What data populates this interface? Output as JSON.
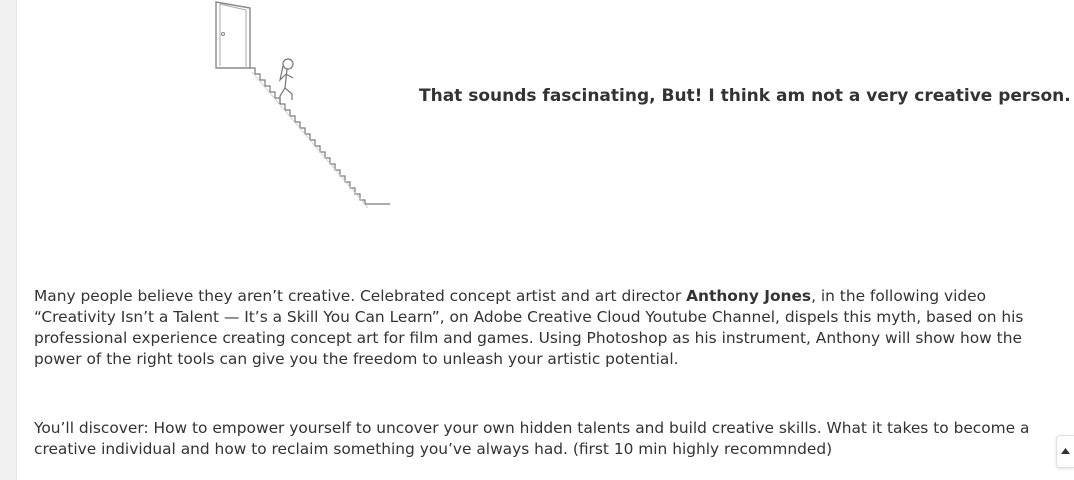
{
  "callout": {
    "text": "That sounds fascinating, But! I think am not a very creative person."
  },
  "paragraph1": {
    "before": "Many people believe they aren’t creative. Celebrated concept artist and art director ",
    "name": "Anthony Jones",
    "after": ", in the following video “Creativity Isn’t a Talent — It’s a Skill You Can Learn”, on Adobe Creative Cloud Youtube Channel, dispels this myth, based on his professional experience creating concept art for film and games. Using Photoshop as his instrument, Anthony will show how the power of the right tools can give you the freedom to unleash your artistic potential."
  },
  "paragraph2": {
    "text": "You’ll discover: How to empower yourself to uncover your own hidden talents and build creative skills. What it takes to become a creative individual and how to reclaim something you’ve always had. (first 10 min highly recommnded)"
  },
  "icons": {
    "illustration": "stick-figure-climbing-stairs-to-door",
    "scroll_top": "caret-up-icon"
  },
  "colors": {
    "text": "#333333",
    "rail": "#f1f1f1"
  }
}
